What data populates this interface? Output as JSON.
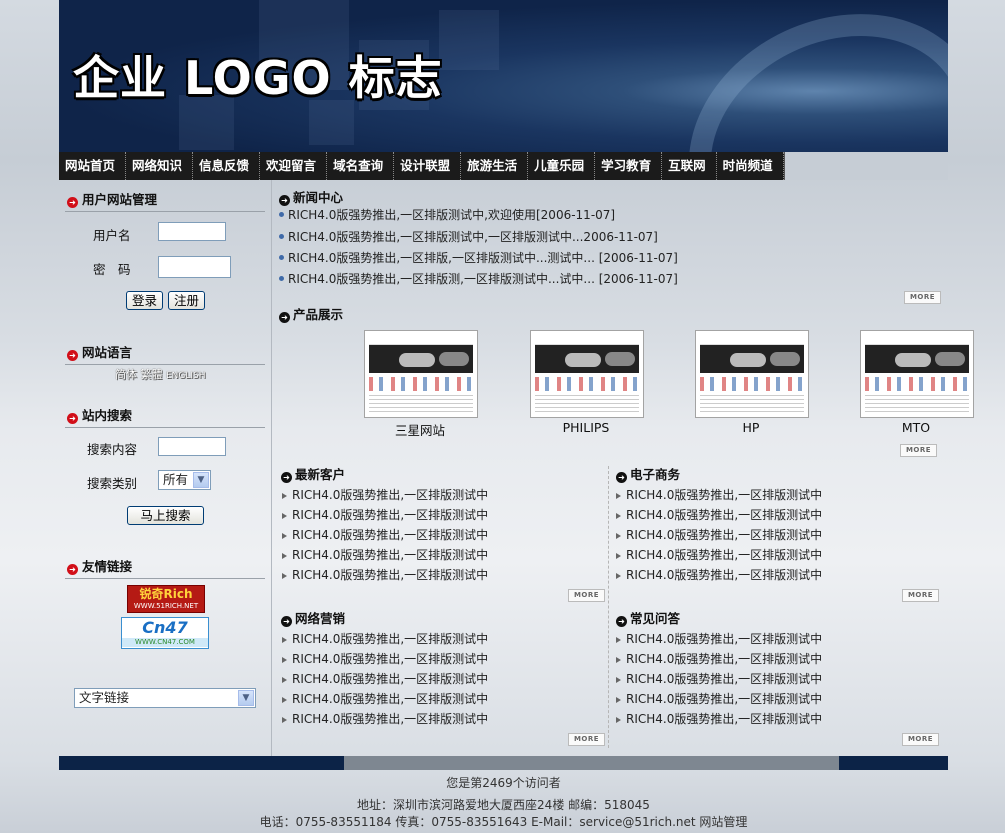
{
  "banner": {
    "logo_text": "企业 LOGO 标志"
  },
  "nav": [
    "网站首页",
    "网络知识",
    "信息反馈",
    "欢迎留言",
    "域名查询",
    "设计联盟",
    "旅游生活",
    "儿童乐园",
    "学习教育",
    "互联网",
    "时尚频道"
  ],
  "sidebar": {
    "login": {
      "title": "用户网站管理",
      "username_label": "用户名",
      "password_label": "密　码",
      "login_btn": "登录",
      "register_btn": "注册"
    },
    "language": {
      "title": "网站语言",
      "options": [
        "简体",
        "繁體",
        "ENGLISH"
      ]
    },
    "search": {
      "title": "站内搜索",
      "content_label": "搜索内容",
      "type_label": "搜索类别",
      "type_value": "所有",
      "search_btn": "马上搜索"
    },
    "links": {
      "title": "友情链接",
      "logo1_text": "锐奇Rich",
      "logo1_sub": "WWW.51RICH.NET",
      "logo2_text": "Cn47",
      "logo2_sub": "WWW.CN47.COM",
      "select_value": "文字链接"
    }
  },
  "main": {
    "news": {
      "title": "新闻中心",
      "items": [
        "RICH4.0版强势推出,一区排版测试中,欢迎使用[2006-11-07]",
        "RICH4.0版强势推出,一区排版测试中,一区排版测试中...2006-11-07]",
        "RICH4.0版强势推出,一区排版,一区排版测试中...测试中... [2006-11-07]",
        "RICH4.0版强势推出,一区排版测,一区排版测试中...试中... [2006-11-07]"
      ]
    },
    "more_label": "MORE",
    "products": {
      "title": "产品展示",
      "items": [
        "三星网站",
        "PHILIPS",
        "HP",
        "MTO"
      ]
    },
    "clients": {
      "title": "最新客户",
      "items": [
        "RICH4.0版强势推出,一区排版测试中",
        "RICH4.0版强势推出,一区排版测试中",
        "RICH4.0版强势推出,一区排版测试中",
        "RICH4.0版强势推出,一区排版测试中",
        "RICH4.0版强势推出,一区排版测试中"
      ]
    },
    "ecommerce": {
      "title": "电子商务",
      "items": [
        "RICH4.0版强势推出,一区排版测试中",
        "RICH4.0版强势推出,一区排版测试中",
        "RICH4.0版强势推出,一区排版测试中",
        "RICH4.0版强势推出,一区排版测试中",
        "RICH4.0版强势推出,一区排版测试中"
      ]
    },
    "marketing": {
      "title": "网络营销",
      "items": [
        "RICH4.0版强势推出,一区排版测试中",
        "RICH4.0版强势推出,一区排版测试中",
        "RICH4.0版强势推出,一区排版测试中",
        "RICH4.0版强势推出,一区排版测试中",
        "RICH4.0版强势推出,一区排版测试中"
      ]
    },
    "faq": {
      "title": "常见问答",
      "items": [
        "RICH4.0版强势推出,一区排版测试中",
        "RICH4.0版强势推出,一区排版测试中",
        "RICH4.0版强势推出,一区排版测试中",
        "RICH4.0版强势推出,一区排版测试中",
        "RICH4.0版强势推出,一区排版测试中"
      ]
    }
  },
  "footer": {
    "visitors": "您是第2469个访问者",
    "address": "地址：深圳市滨河路爱地大厦西座24楼 邮编：518045",
    "contact": "电话：0755-83551184 传真：0755-83551643 E-Mail：service@51rich.net 网站管理"
  }
}
